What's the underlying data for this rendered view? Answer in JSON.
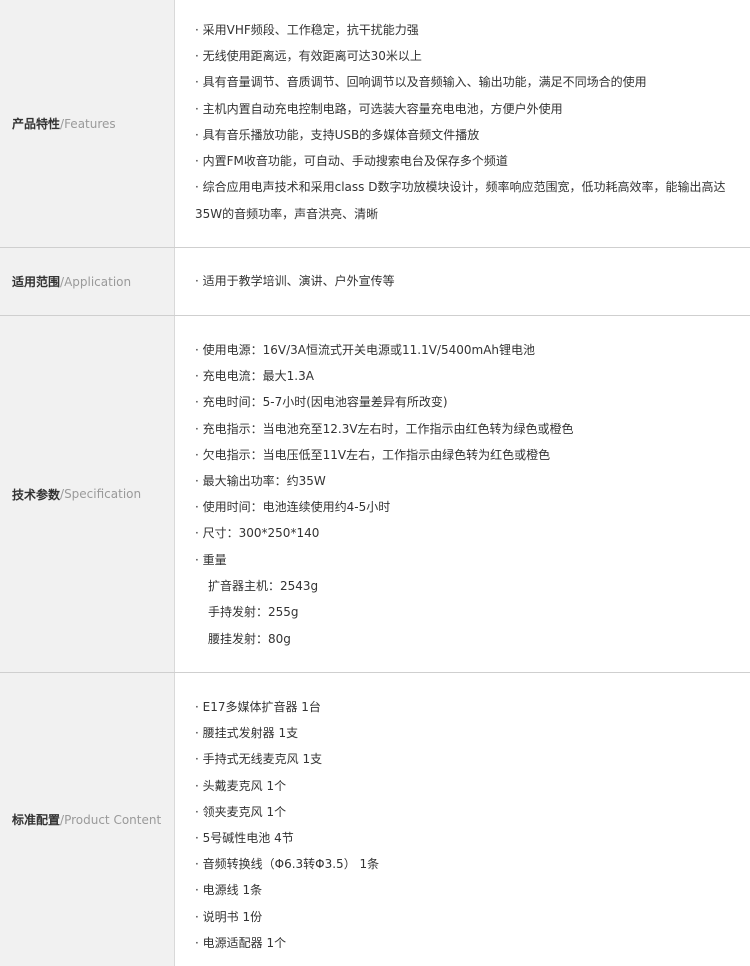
{
  "sections": [
    {
      "label_zh": "产品特性",
      "label_en": "Features",
      "items": [
        "· 采用VHF频段、工作稳定，抗干扰能力强",
        "· 无线使用距离远，有效距离可达30米以上",
        "· 具有音量调节、音质调节、回响调节以及音频输入、输出功能，满足不同场合的使用",
        "· 主机内置自动充电控制电路，可选装大容量充电电池，方便户外使用",
        "· 具有音乐播放功能，支持USB的多媒体音频文件播放",
        "· 内置FM收音功能，可自动、手动搜索电台及保存多个频道",
        "· 综合应用电声技术和采用class D数字功放模块设计，频率响应范围宽，低功耗高效率，能输出高达",
        "35W的音频功率，声音洪亮、清晰"
      ]
    },
    {
      "label_zh": "适用范围",
      "label_en": "Application",
      "items": [
        "· 适用于教学培训、演讲、户外宣传等"
      ]
    },
    {
      "label_zh": "技术参数",
      "label_en": "Specification",
      "items": [
        "· 使用电源：16V/3A恒流式开关电源或11.1V/5400mAh锂电池",
        "· 充电电流：最大1.3A",
        "· 充电时间：5-7小时(因电池容量差异有所改变)",
        "· 充电指示：当电池充至12.3V左右时，工作指示由红色转为绿色或橙色",
        "· 欠电指示：当电压低至11V左右，工作指示由绿色转为红色或橙色",
        "· 最大输出功率：约35W",
        "· 使用时间：电池连续使用约4-5小时",
        "· 尺寸：300*250*140",
        "· 重量",
        "扩音器主机：2543g",
        "手持发射：255g",
        "腰挂发射：80g"
      ]
    },
    {
      "label_zh": "标准配置",
      "label_en": "Product Content",
      "items": [
        "· E17多媒体扩音器 1台",
        "· 腰挂式发射器 1支",
        "· 手持式无线麦克风 1支",
        "· 头戴麦克风 1个",
        "· 领夹麦克风 1个",
        "· 5号碱性电池 4节",
        "· 音频转换线（Φ6.3转Φ3.5） 1条",
        "· 电源线 1条",
        "· 说明书 1份",
        "· 电源适配器 1个"
      ]
    }
  ],
  "label_separator": "/"
}
